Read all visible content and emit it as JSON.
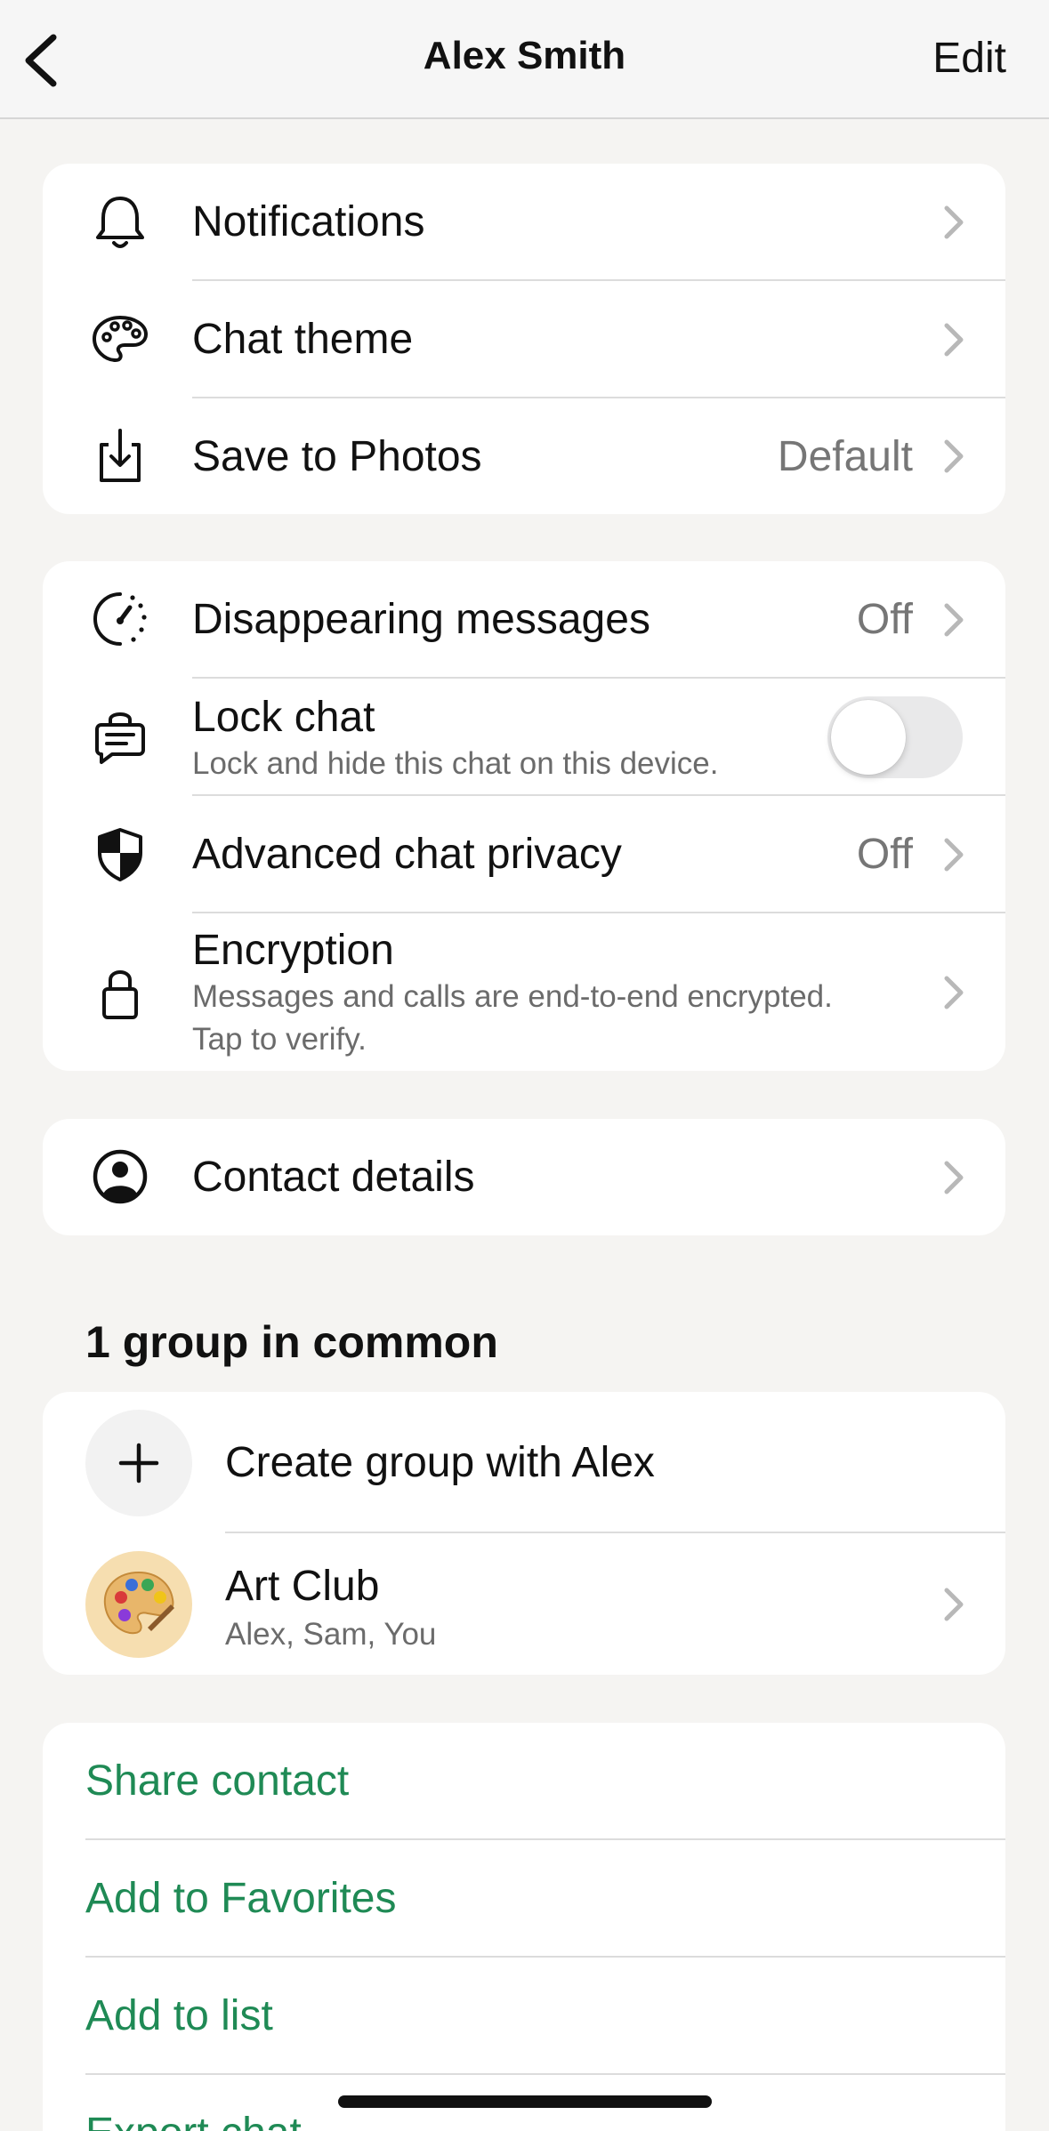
{
  "header": {
    "title": "Alex Smith",
    "edit_label": "Edit"
  },
  "card1": {
    "notifications": "Notifications",
    "chat_theme": "Chat theme",
    "save_photos": "Save to Photos",
    "save_photos_value": "Default"
  },
  "card2": {
    "disappearing": "Disappearing messages",
    "disappearing_value": "Off",
    "lock_chat": "Lock chat",
    "lock_chat_sub": "Lock and hide this chat on this device.",
    "lock_chat_enabled": false,
    "advanced_privacy": "Advanced chat privacy",
    "advanced_privacy_value": "Off",
    "encryption": "Encryption",
    "encryption_sub1": "Messages and calls are end-to-end encrypted.",
    "encryption_sub2": "Tap to verify."
  },
  "card3": {
    "contact_details": "Contact details"
  },
  "groups": {
    "header": "1 group in common",
    "create_group": "Create group with Alex",
    "group_name": "Art Club",
    "group_members": "Alex, Sam, You"
  },
  "actions": {
    "share_contact": "Share contact",
    "add_favorites": "Add to Favorites",
    "add_list": "Add to list",
    "export_chat": "Export chat"
  },
  "colors": {
    "accent": "#1f8a55",
    "background": "#f5f4f2",
    "card": "#ffffff",
    "secondary_text": "#767676"
  }
}
